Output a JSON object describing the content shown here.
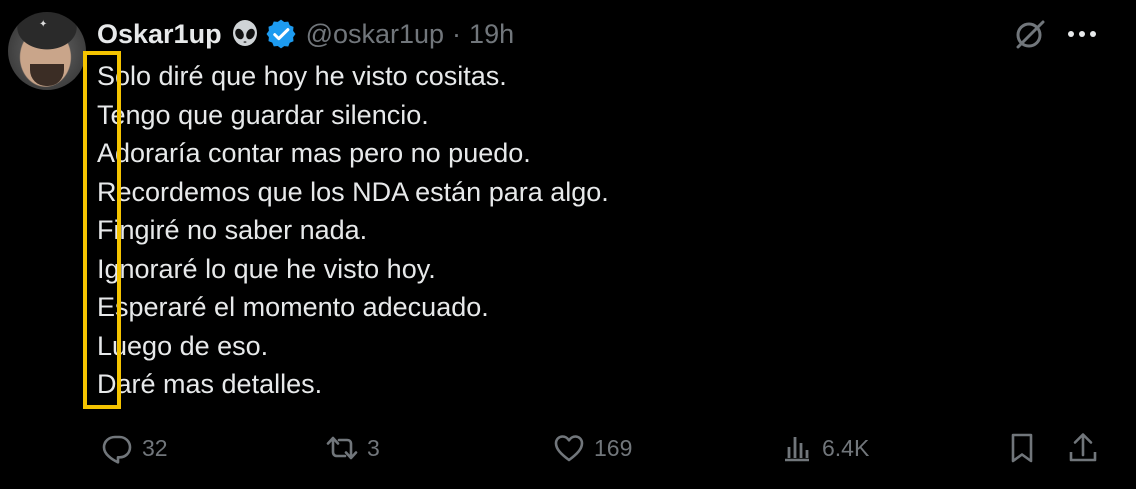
{
  "tweet": {
    "author_name": "Oskar1up",
    "author_emoji": "alien-emoji",
    "verified": true,
    "handle": "@oskar1up",
    "separator": "·",
    "time": "19h",
    "lines": [
      "Solo diré que hoy he visto cositas.",
      "Tengo que guardar silencio.",
      "Adoraría contar mas pero no puedo.",
      "Recordemos que los NDA están para algo.",
      "Fingiré no saber nada.",
      "Ignoraré lo que he visto hoy.",
      "Esperaré el momento adecuado.",
      "Luego de eso.",
      "Daré mas detalles."
    ],
    "highlight_color": "#f5c400"
  },
  "actions": {
    "replies": "32",
    "retweets": "3",
    "likes": "169",
    "views": "6.4K"
  },
  "colors": {
    "background": "#000000",
    "text": "#e7e9ea",
    "muted": "#71767b",
    "verified": "#1d9bf0"
  },
  "icons": {
    "grok": "grok-icon",
    "more": "more-icon",
    "reply": "reply-icon",
    "retweet": "retweet-icon",
    "like": "heart-icon",
    "views": "views-icon",
    "bookmark": "bookmark-icon",
    "share": "share-icon"
  }
}
